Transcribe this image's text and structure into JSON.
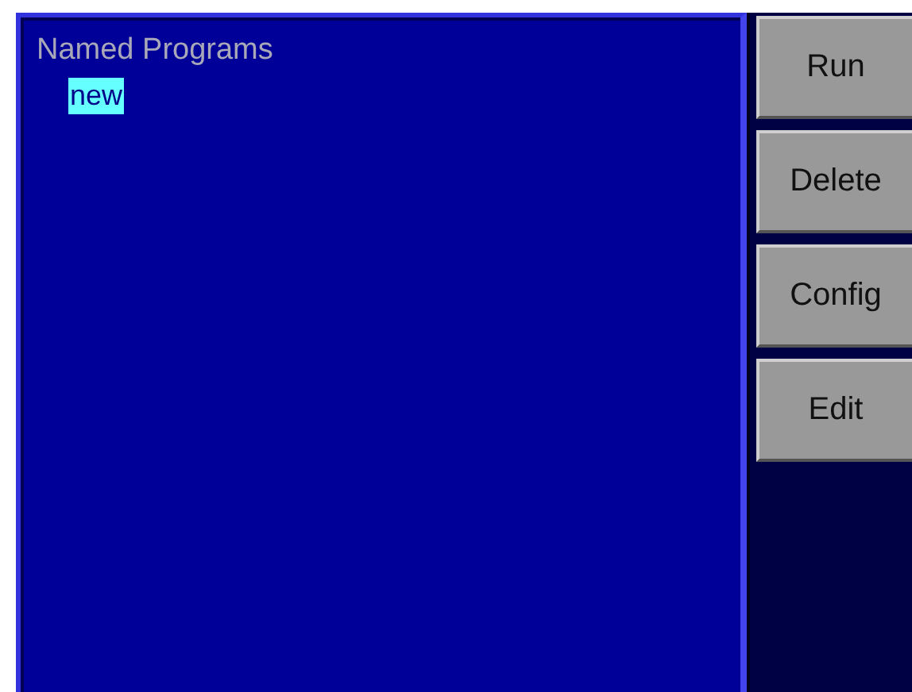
{
  "panel": {
    "title": "Named Programs"
  },
  "programs": [
    {
      "name": "new",
      "selected": true
    }
  ],
  "buttons": [
    {
      "label": "Run"
    },
    {
      "label": "Delete"
    },
    {
      "label": "Config"
    },
    {
      "label": "Edit"
    }
  ]
}
